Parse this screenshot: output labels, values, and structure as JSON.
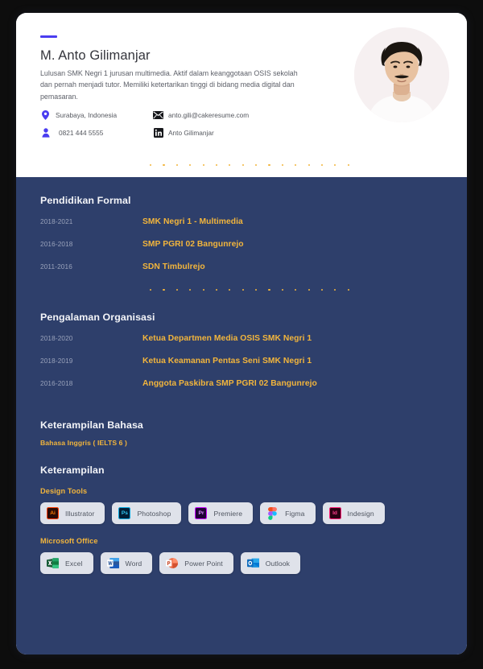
{
  "header": {
    "accent_color": "#4a3df0",
    "name": "M. Anto Gilimanjar",
    "summary": "Lulusan SMK Negri 1 jurusan multimedia. Aktif dalam keanggotaan OSIS sekolah dan pernah menjadi tutor. Memiliki ketertarikan tinggi di bidang media digital dan pemasaran.",
    "contacts": [
      {
        "icon": "location-pin-icon",
        "text": "Surabaya, Indonesia"
      },
      {
        "icon": "envelope-icon",
        "text": "anto.gili@cakeresume.com"
      },
      {
        "icon": "person-icon",
        "text": "0821 444 5555"
      },
      {
        "icon": "linkedin-icon",
        "text": "Anto Gilimanjar"
      }
    ],
    "photo_alt": "profile-photo"
  },
  "theme": {
    "navy": "#2e3f6b",
    "gold": "#f2b53c",
    "muted": "#9aa3bb",
    "chip_bg": "#dfe2ea"
  },
  "education": {
    "title": "Pendidikan Formal",
    "entries": [
      {
        "years": "2018-2021",
        "name": "SMK Negri 1 - Multimedia"
      },
      {
        "years": "2016-2018",
        "name": "SMP PGRI 02 Bangunrejo"
      },
      {
        "years": "2011-2016",
        "name": "SDN Timbulrejo"
      }
    ]
  },
  "organization": {
    "title": "Pengalaman Organisasi",
    "entries": [
      {
        "years": "2018-2020",
        "name": "Ketua Departmen Media OSIS SMK Negri 1"
      },
      {
        "years": "2018-2019",
        "name": "Ketua Keamanan Pentas Seni SMK Negri 1"
      },
      {
        "years": "2016-2018",
        "name": "Anggota Paskibra SMP PGRI 02 Bangunrejo"
      }
    ]
  },
  "language": {
    "title": "Keterampilan Bahasa",
    "value": "Bahasa Inggris ( IELTS 6 )"
  },
  "skills": {
    "title": "Keterampilan",
    "groups": [
      {
        "label": "Design Tools",
        "items": [
          {
            "name": "Illustrator",
            "icon": "adobe-illustrator-icon",
            "mark": "Ai",
            "bg": "#2b0b06",
            "fg": "#ff7c00",
            "border": "#ff3c00"
          },
          {
            "name": "Photoshop",
            "icon": "adobe-photoshop-icon",
            "mark": "Ps",
            "bg": "#011e36",
            "fg": "#31c5f0",
            "border": "#00a8e1"
          },
          {
            "name": "Premiere",
            "icon": "adobe-premiere-icon",
            "mark": "Pr",
            "bg": "#1f0035",
            "fg": "#d98eff",
            "border": "#c800ff"
          },
          {
            "name": "Figma",
            "icon": "figma-icon",
            "mark": "",
            "bg": "transparent",
            "fg": "",
            "border": ""
          },
          {
            "name": "Indesign",
            "icon": "adobe-indesign-icon",
            "mark": "Id",
            "bg": "#2b0012",
            "fg": "#ff3d8b",
            "border": "#ff1a75"
          }
        ]
      },
      {
        "label": "Microsoft Office",
        "items": [
          {
            "name": "Excel",
            "icon": "microsoft-excel-icon",
            "mark": "X",
            "bg": "#1d6f42",
            "fg": "#ffffff",
            "border": ""
          },
          {
            "name": "Word",
            "icon": "microsoft-word-icon",
            "mark": "W",
            "bg": "#2b579a",
            "fg": "#ffffff",
            "border": ""
          },
          {
            "name": "Power Point",
            "icon": "microsoft-powerpoint-icon",
            "mark": "P",
            "bg": "#d24726",
            "fg": "#ffffff",
            "border": ""
          },
          {
            "name": "Outlook",
            "icon": "microsoft-outlook-icon",
            "mark": "O",
            "bg": "#0f6cbd",
            "fg": "#ffffff",
            "border": ""
          }
        ]
      }
    ]
  },
  "dividers": {
    "dot_count": 16,
    "dot_color": "#f2b53c"
  }
}
